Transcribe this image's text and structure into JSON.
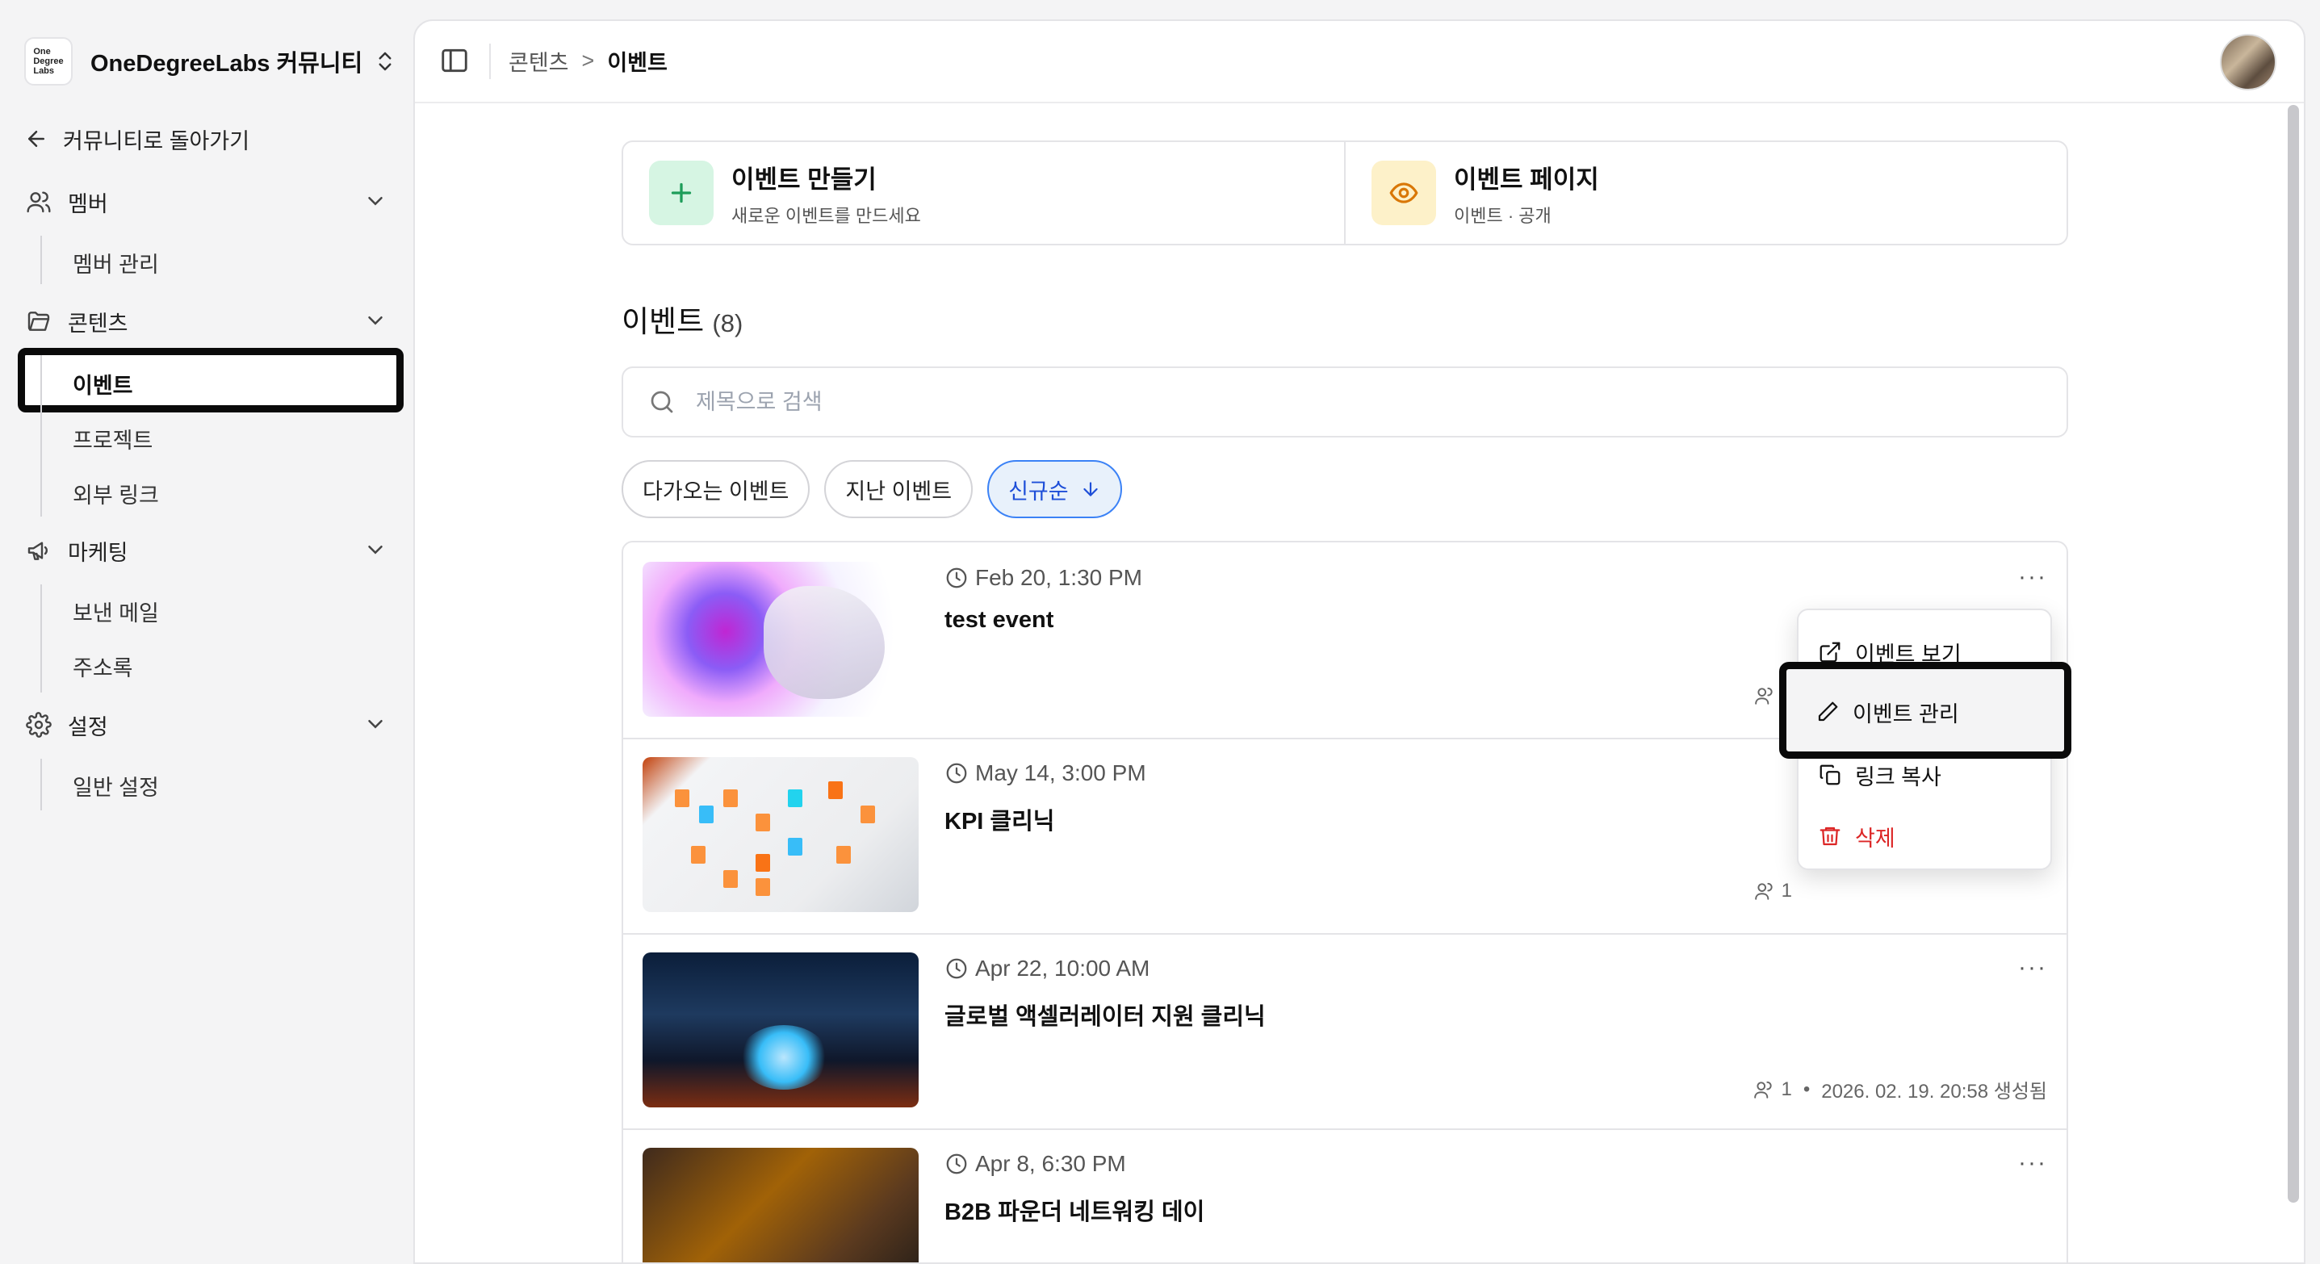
{
  "sidebar": {
    "org_name": "OneDegreeLabs 커뮤니티",
    "logo_text": "One Degree Labs",
    "back_label": "커뮤니티로 돌아가기",
    "groups": [
      {
        "label": "멤버",
        "icon": "users-icon",
        "items": [
          "멤버 관리"
        ]
      },
      {
        "label": "콘텐츠",
        "icon": "folder-icon",
        "items": [
          "이벤트",
          "프로젝트",
          "외부 링크"
        ]
      },
      {
        "label": "마케팅",
        "icon": "megaphone-icon",
        "items": [
          "보낸 메일",
          "주소록"
        ]
      },
      {
        "label": "설정",
        "icon": "gear-icon",
        "items": [
          "일반 설정"
        ]
      }
    ],
    "active_item": "이벤트"
  },
  "header": {
    "breadcrumb": [
      "콘텐츠",
      "이벤트"
    ],
    "breadcrumb_separator": ">"
  },
  "actions": [
    {
      "title": "이벤트 만들기",
      "subtitle": "새로운 이벤트를 만드세요",
      "icon": "plus-icon",
      "color": "#1e9d5a"
    },
    {
      "title": "이벤트 페이지",
      "subtitle": "이벤트 · 공개",
      "icon": "eye-icon",
      "color": "#d97706"
    }
  ],
  "events_section": {
    "title": "이벤트",
    "count": "(8)"
  },
  "search": {
    "placeholder": "제목으로 검색",
    "value": ""
  },
  "filters": [
    {
      "label": "다가오는 이벤트",
      "selected": false
    },
    {
      "label": "지난 이벤트",
      "selected": false
    },
    {
      "label": "신규순",
      "selected": true,
      "icon": "arrow-down-icon"
    }
  ],
  "events": [
    {
      "date": "Feb 20, 1:30 PM",
      "title": "test event",
      "attendees": "1",
      "created": ""
    },
    {
      "date": "May 14, 3:00 PM",
      "title": "KPI 클리닉",
      "attendees": "1",
      "created": ""
    },
    {
      "date": "Apr 22, 10:00 AM",
      "title": "글로벌 액셀러레이터 지원 클리닉",
      "attendees": "1",
      "created": "2026. 02. 19. 20:58 생성됨"
    },
    {
      "date": "Apr 8, 6:30 PM",
      "title": "B2B 파운더 네트워킹 데이",
      "attendees": "",
      "created": ""
    }
  ],
  "more_label": "···",
  "context_menu": {
    "items": [
      {
        "label": "이벤트 보기",
        "icon": "external-link-icon"
      },
      {
        "label": "이벤트 관리",
        "icon": "pencil-icon"
      },
      {
        "label": "링크 복사",
        "icon": "copy-icon"
      },
      {
        "label": "삭제",
        "icon": "trash-icon",
        "danger": true
      }
    ],
    "highlighted": "이벤트 관리"
  },
  "colors": {
    "accent_blue": "#3b82f6",
    "danger": "#dc2626",
    "highlight_border": "#0a0a0a"
  }
}
